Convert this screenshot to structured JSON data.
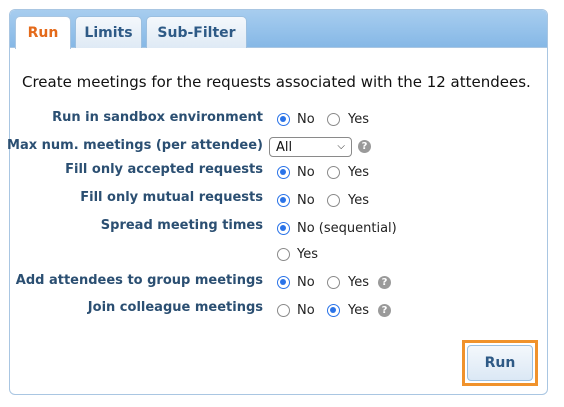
{
  "tabs": [
    {
      "label": "Run",
      "active": true
    },
    {
      "label": "Limits",
      "active": false
    },
    {
      "label": "Sub-Filter",
      "active": false
    }
  ],
  "intro": "Create meetings for the requests associated with the 12 attendees.",
  "rows": {
    "sandbox": {
      "label": "Run in sandbox environment",
      "no": "No",
      "yes": "Yes",
      "selected": "No"
    },
    "max_meetings": {
      "label": "Max num. meetings (per attendee)",
      "value": "All",
      "help": "?"
    },
    "accepted": {
      "label": "Fill only accepted requests",
      "no": "No",
      "yes": "Yes",
      "selected": "No"
    },
    "mutual": {
      "label": "Fill only mutual requests",
      "no": "No",
      "yes": "Yes",
      "selected": "No"
    },
    "spread": {
      "label": "Spread meeting times",
      "no": "No (sequential)",
      "yes": "Yes",
      "selected": "No (sequential)"
    },
    "group": {
      "label": "Add attendees to group meetings",
      "no": "No",
      "yes": "Yes",
      "selected": "No",
      "help": "?"
    },
    "colleague": {
      "label": "Join colleague meetings",
      "no": "No",
      "yes": "Yes",
      "selected": "Yes",
      "help": "?"
    }
  },
  "run_button": {
    "label": "Run"
  },
  "colors": {
    "accent": "#2a73e8",
    "tab_active": "#e46a1a",
    "label": "#2b4f72",
    "highlight": "#f0922c"
  }
}
